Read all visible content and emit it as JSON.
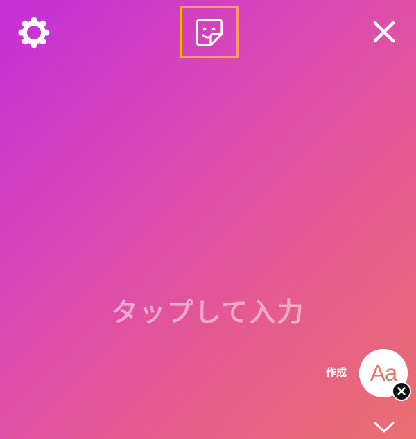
{
  "toolbar": {
    "settings_icon": "gear-icon",
    "sticker_icon": "sticker-icon",
    "close_icon": "close-icon"
  },
  "canvas": {
    "placeholder": "タップして入力",
    "gradient_colors": [
      "#c42fd8",
      "#d847b8",
      "#e35a92",
      "#ea6f70"
    ]
  },
  "text_tool": {
    "create_label": "作成",
    "font_button_text": "Aa",
    "remove_icon": "close-icon",
    "collapse_icon": "chevron-down-icon"
  },
  "colors": {
    "highlight": "#f5b400",
    "font_text": "#e8756a"
  }
}
